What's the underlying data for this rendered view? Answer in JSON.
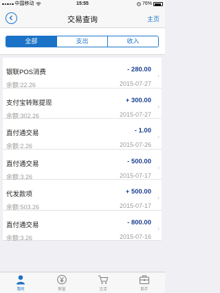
{
  "status_bar": {
    "carrier": "中国移动",
    "time": "15:55",
    "battery": "76%"
  },
  "nav": {
    "title": "交易查询",
    "home_link": "主页"
  },
  "filter_tabs": [
    {
      "label": "全部",
      "active": true
    },
    {
      "label": "支出",
      "active": false
    },
    {
      "label": "收入",
      "active": false
    }
  ],
  "transactions": [
    {
      "name": "银联POS消费",
      "amount": "- 280.00",
      "balance": "余额:22.26",
      "date": "2015-07-27"
    },
    {
      "name": "支付宝转账提现",
      "amount": "+ 300.00",
      "balance": "余额:302.26",
      "date": "2015-07-27"
    },
    {
      "name": "直付通交易",
      "amount": "- 1.00",
      "balance": "余额:2.26",
      "date": "2015-07-26"
    },
    {
      "name": "直付通交易",
      "amount": "- 500.00",
      "balance": "余额:3.26",
      "date": "2015-07-17"
    },
    {
      "name": "代发款项",
      "amount": "+ 500.00",
      "balance": "余额:503.26",
      "date": "2015-07-17"
    },
    {
      "name": "直付通交易",
      "amount": "- 800.00",
      "balance": "余额:3.26",
      "date": "2015-07-16"
    }
  ],
  "tab_bar": [
    {
      "label": "我的",
      "icon": "person-icon",
      "active": true
    },
    {
      "label": "财富",
      "icon": "yen-icon",
      "active": false
    },
    {
      "label": "生活",
      "icon": "cart-icon",
      "active": false
    },
    {
      "label": "助手",
      "icon": "briefcase-icon",
      "active": false
    }
  ],
  "colors": {
    "accent": "#1a73c7",
    "amount": "#1a3f8f",
    "muted": "#9a9a9a"
  }
}
